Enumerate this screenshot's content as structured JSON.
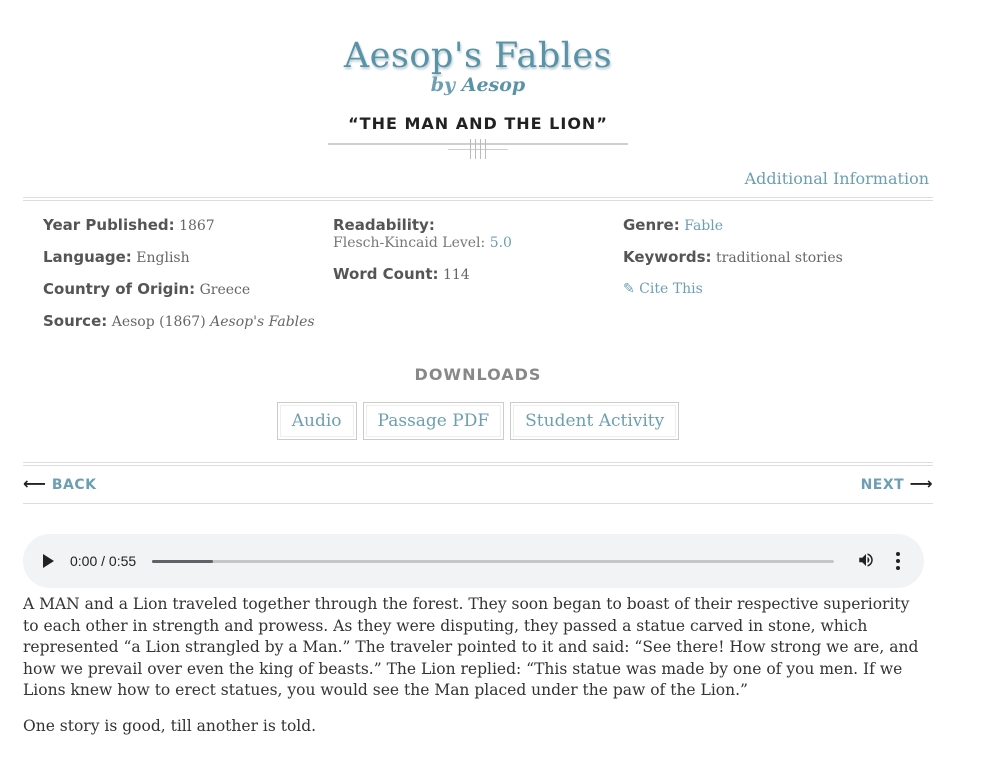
{
  "header": {
    "book_title": "Aesop's Fables",
    "by": "by",
    "author": "Aesop",
    "story_title": "“THE MAN AND THE LION”",
    "additional_info": "Additional Information"
  },
  "info": {
    "year_label": "Year Published:",
    "year_value": "1867",
    "language_label": "Language:",
    "language_value": "English",
    "country_label": "Country of Origin:",
    "country_value": "Greece",
    "source_label": "Source:",
    "source_value": "Aesop (1867)",
    "source_title": "Aesop's Fables",
    "readability_label": "Readability:",
    "fk_label": "Flesch-Kincaid Level:",
    "fk_value": "5.0",
    "wordcount_label": "Word Count:",
    "wordcount_value": "114",
    "genre_label": "Genre:",
    "genre_value": "Fable",
    "keywords_label": "Keywords:",
    "keywords_value": "traditional stories",
    "cite_label": "✎ Cite This"
  },
  "downloads": {
    "heading": "DOWNLOADS",
    "buttons": [
      "Audio",
      "Passage PDF",
      "Student Activity"
    ]
  },
  "nav": {
    "back": "BACK",
    "next": "NEXT"
  },
  "audio": {
    "time": "0:00 / 0:55",
    "progress": 0.09
  },
  "story": {
    "paragraphs": [
      "A MAN and a Lion traveled together through the forest. They soon began to boast of their respective superiority to each other in strength and prowess. As they were disputing, they passed a statue carved in stone, which represented “a Lion strangled by a Man.” The traveler pointed to it and said: “See there! How strong we are, and how we prevail over even the king of beasts.” The Lion replied: “This statue was made by one of you men. If we Lions knew how to erect statues, you would see the Man placed under the paw of the Lion.”",
      "One story is good, till another is told."
    ]
  }
}
